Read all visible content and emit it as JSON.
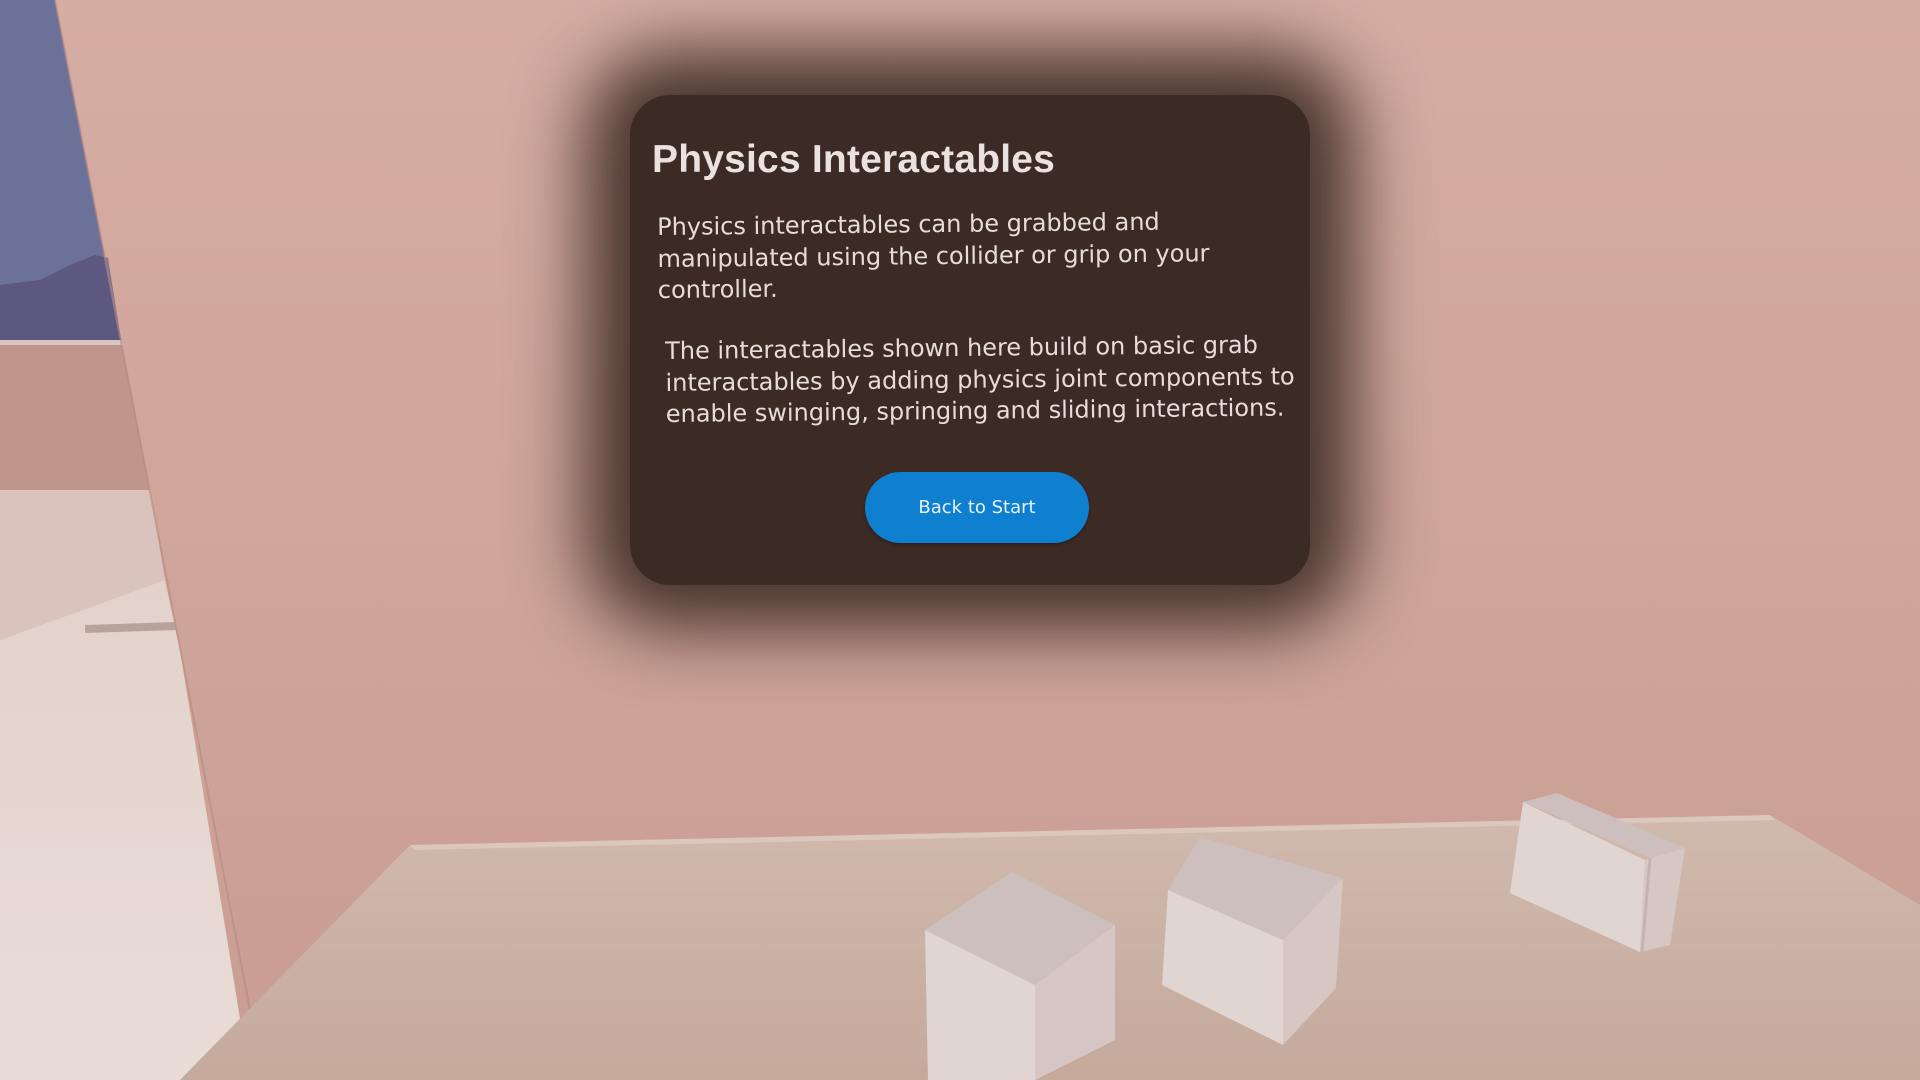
{
  "panel": {
    "title": "Physics Interactables",
    "paragraph1": "Physics interactables can be grabbed and manipulated using the collider or grip on your controller.",
    "paragraph2": "The interactables shown here build on basic grab interactables by adding physics joint components to enable swinging, springing and sliding interactions.",
    "button_label": "Back to Start"
  },
  "colors": {
    "wall": "#cfa69c",
    "panel": "#3c2a25",
    "button": "#0f7fd0",
    "table": "#c9b1a4",
    "sky": "#6b7199",
    "cube": "#e2d6d3"
  }
}
